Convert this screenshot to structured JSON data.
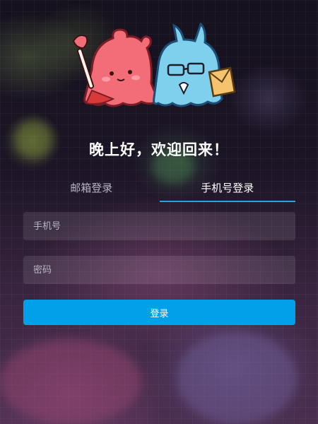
{
  "greeting": "晚上好，欢迎回来！",
  "tabs": [
    {
      "label": "邮箱登录",
      "active": false
    },
    {
      "label": "手机号登录",
      "active": true
    }
  ],
  "phone_field": {
    "placeholder": "手机号",
    "value": ""
  },
  "password_field": {
    "placeholder": "密码",
    "value": ""
  },
  "login_button": {
    "label": "登录"
  },
  "colors": {
    "accent": "#00a1e9",
    "tab_underline": "#1ea7e8",
    "pink_mascot": "#f26d78",
    "blue_mascot": "#7fd0ec"
  },
  "mascots": [
    {
      "name": "pink-bear-mascot-icon",
      "holding": "paintbrush-icon"
    },
    {
      "name": "blue-ghost-mascot-icon",
      "holding": "envelope-icon"
    }
  ]
}
